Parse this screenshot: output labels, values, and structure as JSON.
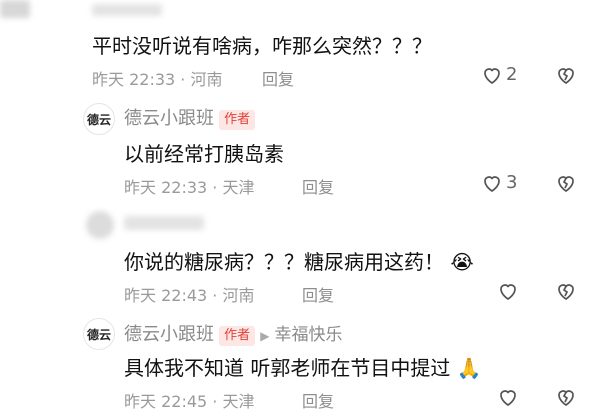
{
  "comments": [
    {
      "content": "平时没听说有啥病，咋那么突然？？？",
      "time": "昨天 22:33",
      "location": "河南",
      "reply_label": "回复",
      "likes": "2"
    },
    {
      "author": "德云小跟班",
      "author_badge": "作者",
      "content": "以前经常打胰岛素",
      "time": "昨天 22:33",
      "location": "天津",
      "reply_label": "回复",
      "likes": "3"
    },
    {
      "content": "你说的糖尿病？？？糖尿病用这药！",
      "emoji": "😭",
      "time": "昨天 22:43",
      "location": "河南",
      "reply_label": "回复",
      "likes": ""
    },
    {
      "author": "德云小跟班",
      "author_badge": "作者",
      "reply_to": "幸福快乐",
      "content": "具体我不知道 听郭老师在节目中提过",
      "emoji": "🙏",
      "time": "昨天 22:45",
      "location": "天津",
      "reply_label": "回复",
      "likes": ""
    }
  ],
  "avatar_logo_text": "德云",
  "colors": {
    "badge_text": "#e0423a",
    "badge_bg": "#fde7e4",
    "meta": "#9a9a9a"
  }
}
